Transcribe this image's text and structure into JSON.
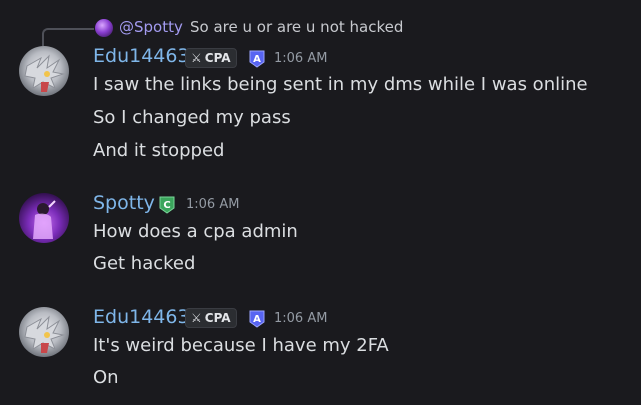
{
  "reply": {
    "mention": "@Spotty",
    "text": "So are u or are u not hacked"
  },
  "messages": [
    {
      "author": "Edu14463",
      "tag": "CPA",
      "role_icon": "A",
      "time": "1:06 AM",
      "lines": [
        "I saw the links being sent in my dms while I was online",
        "So I changed my pass",
        "And it stopped"
      ]
    },
    {
      "author": "Spotty",
      "role_icon": "C",
      "time": "1:06 AM",
      "lines": [
        "How does a cpa admin",
        "Get hacked"
      ]
    },
    {
      "author": "Edu14463",
      "tag": "CPA",
      "role_icon": "A",
      "time": "1:06 AM",
      "lines": [
        "It's weird because I have my 2FA",
        "On"
      ]
    }
  ],
  "colors": {
    "background": "#1a1a1e",
    "username": "#7fb6e9",
    "mention": "#a39bf0",
    "timestamp": "#949ba4",
    "badge_blue": "#5865f2",
    "badge_green": "#3ba55c"
  },
  "icons": {
    "tag_icon": "sword-icon",
    "admin_badge": "shield-a-icon",
    "c_badge": "shield-c-icon"
  }
}
